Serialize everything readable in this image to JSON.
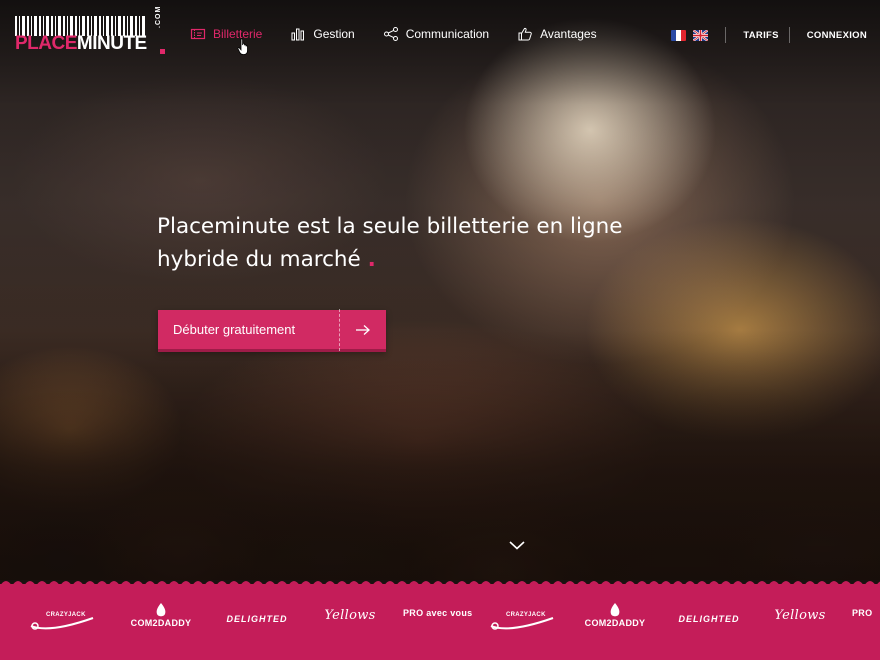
{
  "brand": {
    "logo_part1": "PLACE",
    "logo_part2": "MINUTE",
    "logo_suffix": ".COM",
    "accent_color": "#e0286a"
  },
  "nav": {
    "items": [
      {
        "label": "Billetterie",
        "icon": "ticket-icon",
        "active": true
      },
      {
        "label": "Gestion",
        "icon": "bar-chart-icon",
        "active": false
      },
      {
        "label": "Communication",
        "icon": "share-icon",
        "active": false
      },
      {
        "label": "Avantages",
        "icon": "thumbs-up-icon",
        "active": false
      }
    ]
  },
  "header_right": {
    "languages": [
      "fr-flag-icon",
      "uk-flag-icon"
    ],
    "tarifs": "TARIFS",
    "connexion": "CONNEXION"
  },
  "hero": {
    "headline_line1": "Placeminute est la seule billetterie en ligne",
    "headline_line2": "hybride du marché",
    "headline_dot": ".",
    "cta_label": "Débuter gratuitement",
    "cta_icon": "arrow-right-icon",
    "scroll_icon": "chevron-down-icon"
  },
  "partners": {
    "band_color": "#c41d59",
    "logos": [
      {
        "name": "crazyjack-logo",
        "text": "CRAZYJACK"
      },
      {
        "name": "com2daddy-logo",
        "text": "COM2DADDY"
      },
      {
        "name": "delighted-logo",
        "text": "DELIGHTED"
      },
      {
        "name": "yellows-logo",
        "text": "Yellows"
      },
      {
        "name": "pro-avec-vous-logo",
        "text": "PRO avec vous"
      },
      {
        "name": "crazyjack-logo-2",
        "text": "CRAZYJACK"
      },
      {
        "name": "com2daddy-logo-2",
        "text": "COM2DADDY"
      },
      {
        "name": "delighted-logo-2",
        "text": "DELIGHTED"
      },
      {
        "name": "yellows-logo-2",
        "text": "Yellows"
      },
      {
        "name": "pro-logo-partial",
        "text": "PRO"
      }
    ]
  }
}
